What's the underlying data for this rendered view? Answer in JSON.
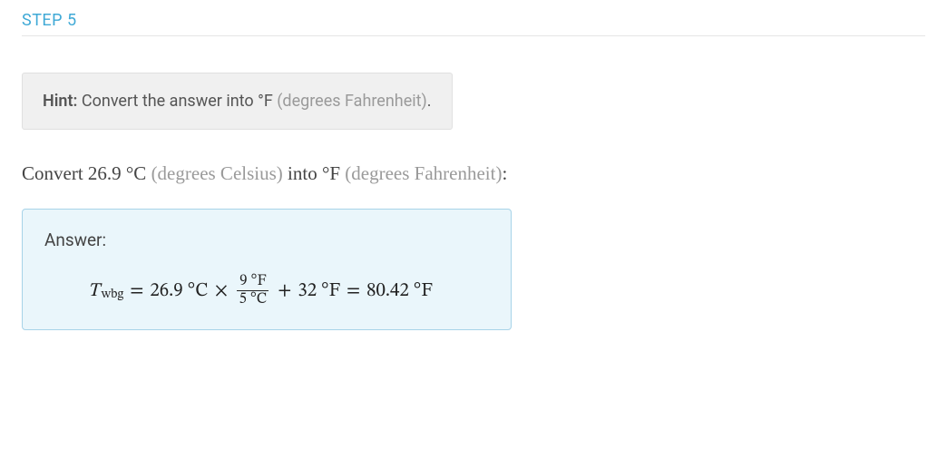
{
  "step": {
    "label": "STEP 5"
  },
  "hint": {
    "label": "Hint:",
    "text_1": " Convert the answer into ",
    "unit_f": "°F",
    "unit_f_desc": "  (degrees Fahrenheit)",
    "period": "."
  },
  "instruction": {
    "text_1": "Convert ",
    "value_c": "26.9 °C",
    "desc_c": "  (degrees Celsius)",
    "text_2": " into ",
    "unit_f": "°F",
    "desc_f": "  (degrees Fahrenheit)",
    "colon": ":"
  },
  "answer": {
    "label": "Answer:",
    "formula": {
      "var": "T",
      "subscript": "wbg",
      "eq1": " = ",
      "val_c": "26.9 °C",
      "times": "×",
      "frac_num": "9 °F",
      "frac_den": "5 °C",
      "plus": " + ",
      "val_32": "32 °F",
      "eq2": " = ",
      "result": "80.42 °F"
    }
  }
}
